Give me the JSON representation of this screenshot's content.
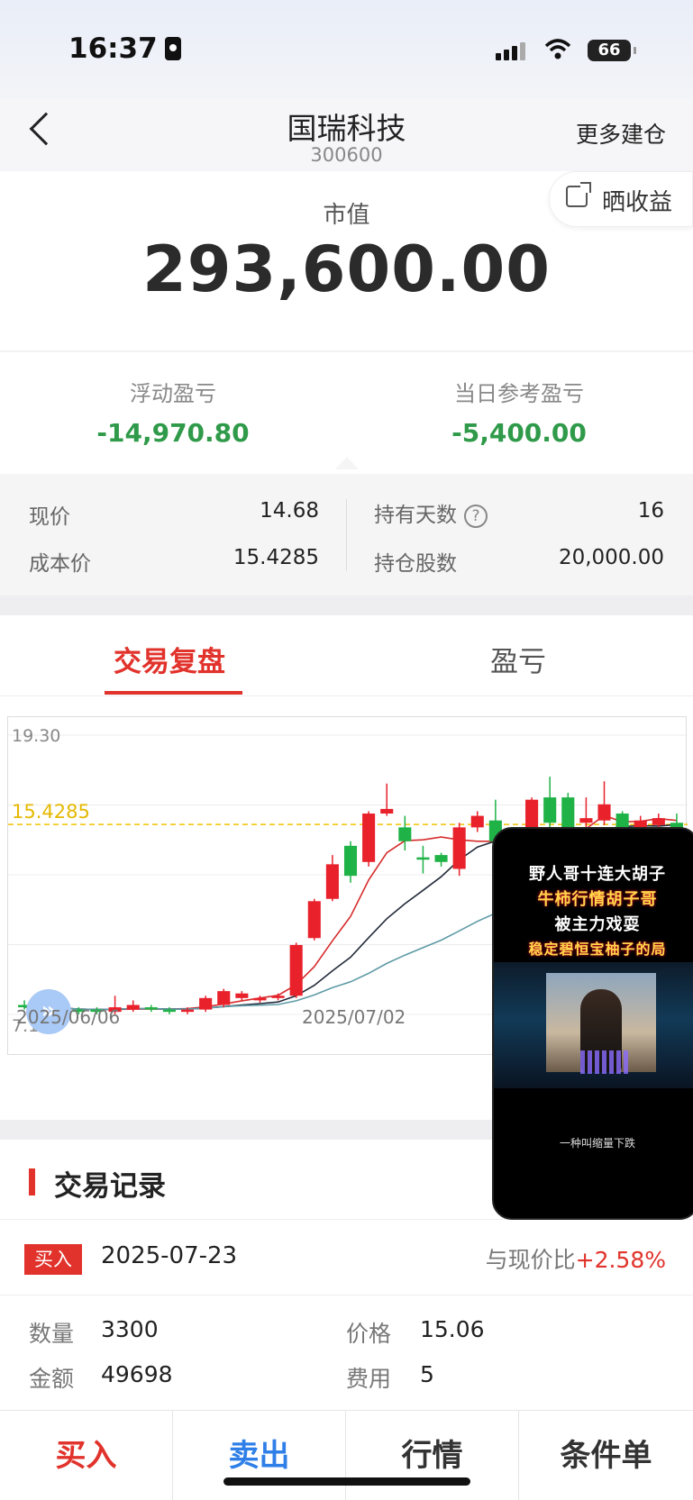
{
  "status": {
    "time": "16:37",
    "battery": "66"
  },
  "header": {
    "stock_name": "国瑞科技",
    "stock_code": "300600",
    "more_label": "更多建仓",
    "share_label": "晒收益"
  },
  "market_value": {
    "label": "市值",
    "value": "293,600.00"
  },
  "pnl": {
    "floating_label": "浮动盈亏",
    "floating_value": "-14,970.80",
    "daily_label": "当日参考盈亏",
    "daily_value": "-5,400.00"
  },
  "details": {
    "price_label": "现价",
    "price_value": "14.68",
    "cost_label": "成本价",
    "cost_value": "15.4285",
    "days_label": "持有天数",
    "days_value": "16",
    "shares_label": "持仓股数",
    "shares_value": "20,000.00",
    "help_icon": "?"
  },
  "tabs": {
    "active": "交易复盘",
    "inactive": "盈亏"
  },
  "chart": {
    "y_max_label": "19.30",
    "y_min_label": "7.19",
    "cost_line_label": "15.4285",
    "date_start": "2025/06/06",
    "date_mid": "2025/07/02",
    "marker_label": "B",
    "colors": {
      "up": "#e8212b",
      "down": "#1fb246",
      "cost": "#f3c300",
      "ma1": "#d62c2c",
      "ma2": "#232a3a",
      "ma3": "#5e9aa6"
    }
  },
  "chart_data": {
    "type": "candlestick",
    "ylim": [
      7.19,
      19.3
    ],
    "reference_line": 15.4285,
    "x_start": "2025/06/06",
    "x_mid": "2025/07/02",
    "candles": [
      [
        7.6,
        7.5,
        7.4,
        7.8
      ],
      [
        7.6,
        7.5,
        7.4,
        7.7
      ],
      [
        7.5,
        7.4,
        7.3,
        7.6
      ],
      [
        7.4,
        7.3,
        7.2,
        7.5
      ],
      [
        7.4,
        7.3,
        7.2,
        7.5
      ],
      [
        7.3,
        7.5,
        7.2,
        8.0
      ],
      [
        7.4,
        7.6,
        7.3,
        7.8
      ],
      [
        7.5,
        7.4,
        7.3,
        7.6
      ],
      [
        7.4,
        7.3,
        7.2,
        7.5
      ],
      [
        7.3,
        7.4,
        7.2,
        7.5
      ],
      [
        7.4,
        7.9,
        7.3,
        8.0
      ],
      [
        7.6,
        8.2,
        7.5,
        8.3
      ],
      [
        7.9,
        8.1,
        7.8,
        8.2
      ],
      [
        7.8,
        7.9,
        7.7,
        8.0
      ],
      [
        7.9,
        8.0,
        7.8,
        8.1
      ],
      [
        8.0,
        10.2,
        7.9,
        10.3
      ],
      [
        10.5,
        12.1,
        10.4,
        12.2
      ],
      [
        12.2,
        13.7,
        12.1,
        14.1
      ],
      [
        14.5,
        13.2,
        12.9,
        14.7
      ],
      [
        13.8,
        15.9,
        13.6,
        16.0
      ],
      [
        15.9,
        16.1,
        15.8,
        17.2
      ],
      [
        15.3,
        14.7,
        14.3,
        15.8
      ],
      [
        14.0,
        13.9,
        13.3,
        14.5
      ],
      [
        14.1,
        13.8,
        13.6,
        14.2
      ],
      [
        13.5,
        15.3,
        13.2,
        15.5
      ],
      [
        15.3,
        15.8,
        15.1,
        16.0
      ],
      [
        15.6,
        14.7,
        14.2,
        16.5
      ],
      [
        13.8,
        13.4,
        13.3,
        14.2
      ],
      [
        14.3,
        16.5,
        11.8,
        16.6
      ],
      [
        16.6,
        15.5,
        15.3,
        17.5
      ],
      [
        16.6,
        15.1,
        14.8,
        16.8
      ],
      [
        15.5,
        15.7,
        15.3,
        16.6
      ],
      [
        15.6,
        16.3,
        15.4,
        17.3
      ],
      [
        15.9,
        15.1,
        14.8,
        16.0
      ],
      [
        15.3,
        15.6,
        15.0,
        15.8
      ],
      [
        15.4,
        15.7,
        15.2,
        15.9
      ],
      [
        15.5,
        15.3,
        15.2,
        15.9
      ]
    ],
    "candle_format": [
      "open",
      "close",
      "low",
      "high"
    ]
  },
  "records": {
    "title": "交易记录",
    "type": "买入",
    "date": "2025-07-23",
    "compare_label": "与现价比",
    "compare_value": "+2.58%",
    "qty_label": "数量",
    "qty_value": "3300",
    "price_label": "价格",
    "price_value": "15.06",
    "amount_label": "金额",
    "amount_value": "49698",
    "fee_label": "费用",
    "fee_value": "5"
  },
  "bottom": {
    "buy": "买入",
    "sell": "卖出",
    "quote": "行情",
    "conditional": "条件单"
  },
  "floating_video": {
    "line1": "野人哥十连大胡子",
    "line2": "牛柿行情胡子哥",
    "line3": "被主力戏耍",
    "line4": "稳定碧恒宝柚子的局",
    "caption": "一种叫缩量下跌"
  }
}
